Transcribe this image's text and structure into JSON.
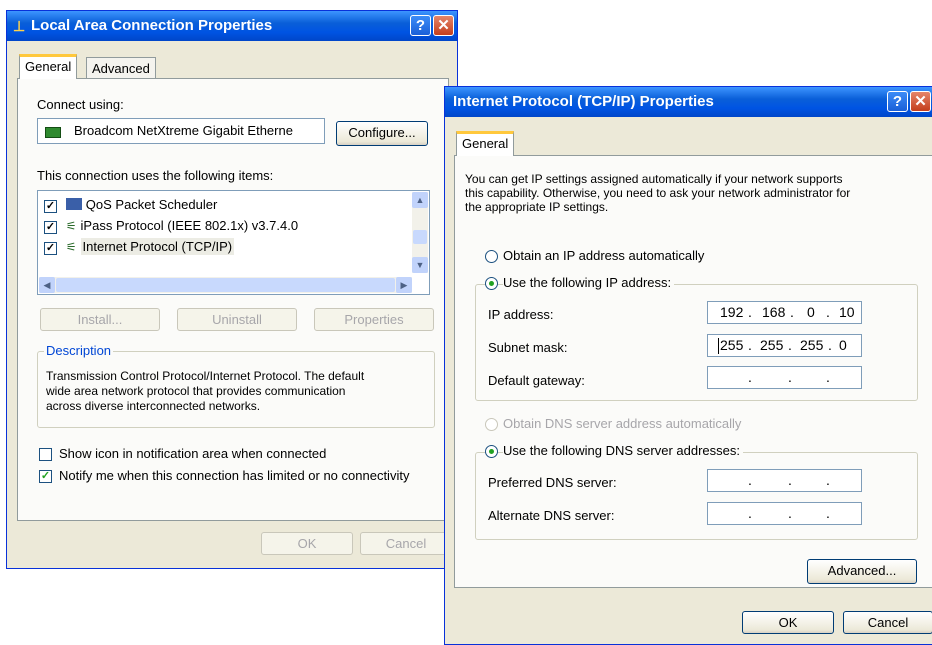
{
  "lac": {
    "title": "Local Area Connection Properties",
    "tabs": [
      "General",
      "Advanced"
    ],
    "connect_using_label": "Connect using:",
    "adapter_name": "Broadcom NetXtreme Gigabit Etherne",
    "configure_label": "Configure...",
    "items_label": "This connection uses the following items:",
    "items": [
      {
        "label": "QoS Packet Scheduler",
        "checked": true,
        "icon": "scheduler-icon"
      },
      {
        "label": "iPass Protocol (IEEE 802.1x) v3.7.4.0",
        "checked": true,
        "icon": "protocol-icon"
      },
      {
        "label": "Internet Protocol (TCP/IP)",
        "checked": true,
        "icon": "protocol-icon"
      }
    ],
    "install_label": "Install...",
    "uninstall_label": "Uninstall",
    "properties_label": "Properties",
    "description_heading": "Description",
    "description_lines": [
      "Transmission Control Protocol/Internet Protocol. The default",
      "wide area network protocol that provides communication",
      "across diverse interconnected networks."
    ],
    "show_icon_label": "Show icon in notification area when connected",
    "notify_label": "Notify me when this connection has limited or no connectivity",
    "ok_label": "OK",
    "cancel_label": "Cancel"
  },
  "tcpip": {
    "title": "Internet Protocol (TCP/IP) Properties",
    "tab": "General",
    "intro_lines": [
      "You can get IP settings assigned automatically if your network supports",
      "this capability. Otherwise, you need to ask your network administrator for",
      "the appropriate IP settings."
    ],
    "obtain_ip_label": "Obtain an IP address automatically",
    "use_ip_label": "Use the following IP address:",
    "ip_address_label": "IP address:",
    "ip_address": [
      "192",
      "168",
      "0",
      "10"
    ],
    "subnet_label": "Subnet mask:",
    "subnet": [
      "255",
      "255",
      "255",
      "0"
    ],
    "gateway_label": "Default gateway:",
    "obtain_dns_label": "Obtain DNS server address automatically",
    "use_dns_label": "Use the following DNS server addresses:",
    "preferred_dns_label": "Preferred DNS server:",
    "alternate_dns_label": "Alternate DNS server:",
    "advanced_label": "Advanced...",
    "ok_label": "OK",
    "cancel_label": "Cancel"
  },
  "colors": {
    "title_bar": "#0054e3",
    "window_face": "#ece9d8",
    "check": "#21a121"
  }
}
